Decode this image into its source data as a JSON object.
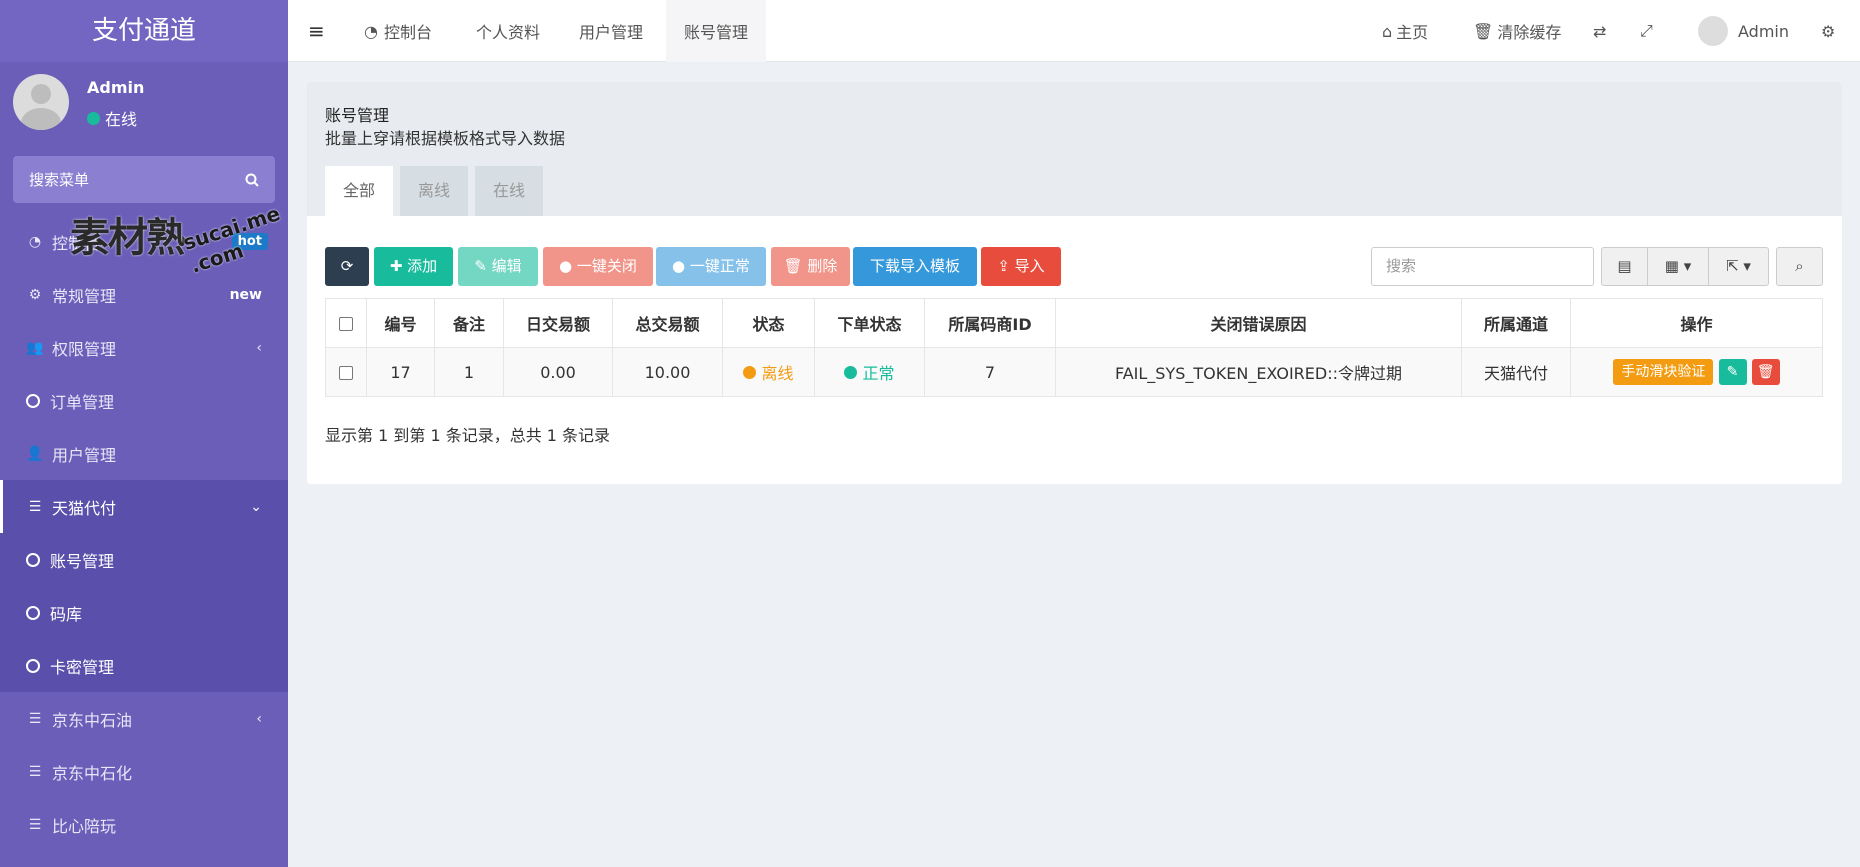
{
  "sidebar": {
    "brand": "支付通道",
    "user": {
      "name": "Admin",
      "status": "在线"
    },
    "search_placeholder": "搜索菜单",
    "menu": [
      {
        "label": "控制台",
        "badge": "hot",
        "icon": "dashboard-icon"
      },
      {
        "label": "常规管理",
        "badge": "new",
        "icon": "cogs-icon"
      },
      {
        "label": "权限管理",
        "arrow": "‹",
        "icon": "users-icon"
      },
      {
        "label": "订单管理",
        "icon": "circle-icon"
      },
      {
        "label": "用户管理",
        "icon": "user-icon"
      },
      {
        "label": "天猫代付",
        "arrow": "⌄",
        "icon": "list-icon"
      }
    ],
    "submenu": [
      {
        "label": "账号管理"
      },
      {
        "label": "码库"
      },
      {
        "label": "卡密管理"
      }
    ],
    "menu_tail": [
      {
        "label": "京东中石油",
        "arrow": "‹",
        "icon": "list-icon"
      },
      {
        "label": "京东中石化",
        "icon": "list-icon"
      },
      {
        "label": "比心陪玩",
        "icon": "list-icon"
      }
    ],
    "watermark": "素材熟",
    "watermark2": "sucai.me .com"
  },
  "topbar": {
    "tabs": [
      "控制台",
      "个人资料",
      "用户管理",
      "账号管理"
    ],
    "home": "主页",
    "clear_cache": "清除缓存",
    "user": "Admin"
  },
  "panel": {
    "title": "账号管理",
    "desc": "批量上穿请根据模板格式导入数据",
    "tabs": [
      "全部",
      "离线",
      "在线"
    ]
  },
  "toolbar": {
    "add": "添加",
    "edit": "编辑",
    "close_all": "一键关闭",
    "normal_all": "一键正常",
    "delete": "删除",
    "download_template": "下载导入模板",
    "import": "导入",
    "search_placeholder": "搜索"
  },
  "table": {
    "headers": [
      "编号",
      "备注",
      "日交易额",
      "总交易额",
      "状态",
      "下单状态",
      "所属码商ID",
      "关闭错误原因",
      "所属通道",
      "操作"
    ],
    "rows": [
      {
        "id": "17",
        "remark": "1",
        "daily": "0.00",
        "total": "10.00",
        "status": "离线",
        "order_status": "正常",
        "merchant_id": "7",
        "error": "FAIL_SYS_TOKEN_EXOIRED::令牌过期",
        "channel": "天猫代付",
        "verify_btn": "手动滑块验证"
      }
    ]
  },
  "footer": {
    "info": "显示第 1 到第 1 条记录，总共 1 条记录"
  },
  "colors": {
    "sidebar": "#6a5eb8",
    "primary_dark": "#2c3e50",
    "success": "#18bc9c",
    "danger": "#e74c3c",
    "info": "#3498db",
    "warning": "#f39c12"
  }
}
